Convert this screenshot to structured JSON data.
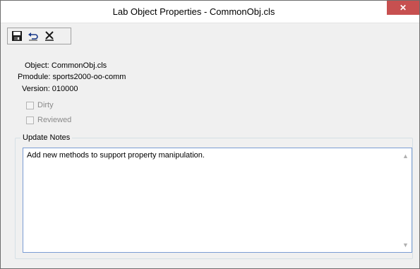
{
  "window": {
    "title": "Lab Object Properties - CommonObj.cls",
    "close_glyph": "✕"
  },
  "toolbar": {
    "buttons": [
      {
        "name": "save",
        "icon": "save-icon"
      },
      {
        "name": "undo",
        "icon": "undo-icon"
      },
      {
        "name": "cancel",
        "icon": "delete-icon"
      }
    ]
  },
  "info": {
    "object": "Object: CommonObj.cls",
    "pmodule": "Pmodule: sports2000-oo-comm",
    "version": "Version: 010000"
  },
  "checkboxes": {
    "dirty": {
      "label": "Dirty",
      "checked": false,
      "enabled": false
    },
    "reviewed": {
      "label": "Reviewed",
      "checked": false,
      "enabled": false
    }
  },
  "notes": {
    "group_label": "Update Notes",
    "text": "Add new methods to support property manipulation."
  },
  "colors": {
    "close_bg": "#c75050",
    "notes_border": "#7a9cd3",
    "group_border": "#d5dfe5"
  }
}
